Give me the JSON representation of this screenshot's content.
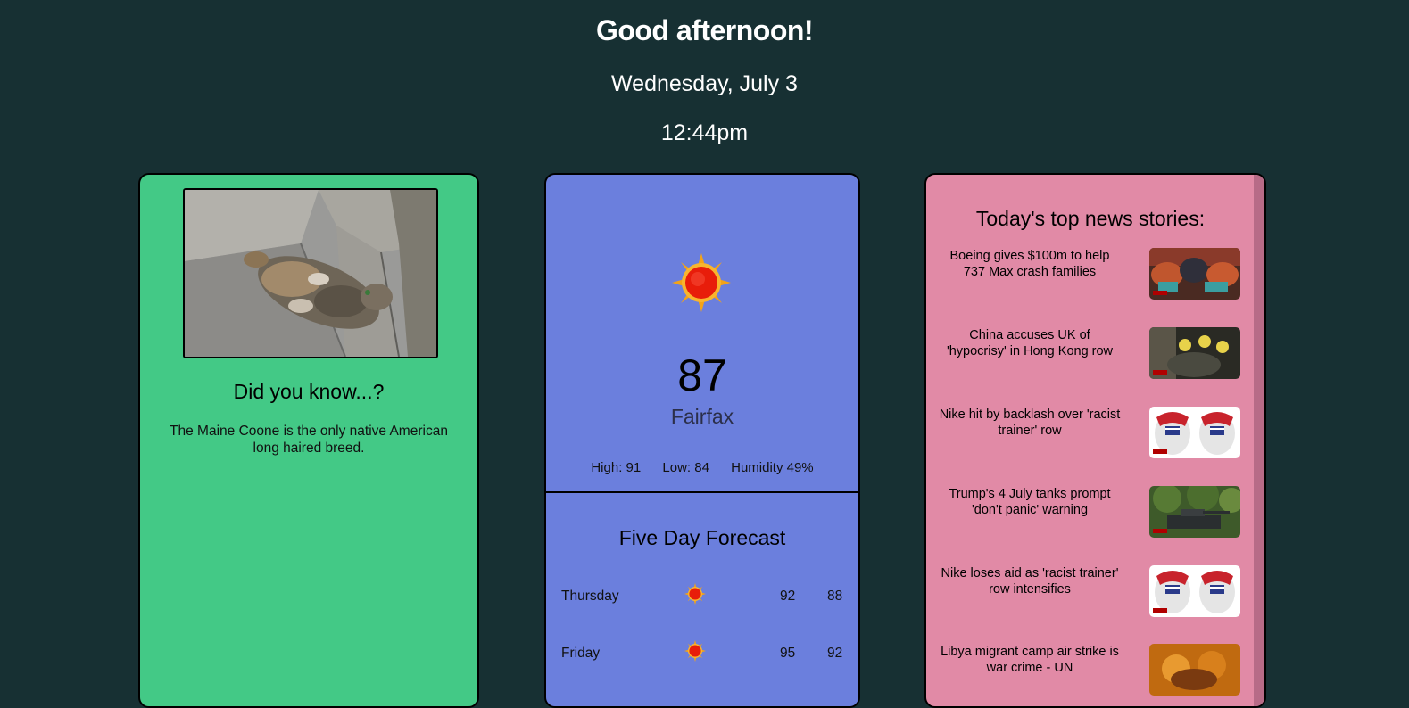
{
  "header": {
    "greeting": "Good afternoon!",
    "date": "Wednesday, July 3",
    "time": "12:44pm"
  },
  "fact": {
    "title": "Did you know...?",
    "text": "The Maine Coone is the only native American long haired breed."
  },
  "weather": {
    "icon": "sun-icon",
    "temperature": "87",
    "city": "Fairfax",
    "high": "High: 91",
    "low": "Low: 84",
    "humidity": "Humidity 49%",
    "forecast_title": "Five Day Forecast",
    "forecast": [
      {
        "day": "Thursday",
        "icon": "sun-icon",
        "high": "92",
        "low": "88"
      },
      {
        "day": "Friday",
        "icon": "sun-icon",
        "high": "95",
        "low": "92"
      }
    ]
  },
  "news": {
    "title": "Today's top news stories:",
    "items": [
      {
        "headline": "Boeing gives $100m to help 737 Max crash families"
      },
      {
        "headline": "China accuses UK of 'hypocrisy' in Hong Kong row"
      },
      {
        "headline": "Nike hit by backlash over 'racist trainer' row"
      },
      {
        "headline": "Trump's 4 July tanks prompt 'don't panic' warning"
      },
      {
        "headline": "Nike loses aid as 'racist trainer' row intensifies"
      },
      {
        "headline": "Libya migrant camp air strike is war crime - UN"
      }
    ]
  },
  "colors": {
    "background": "#173033",
    "fact_card": "#43c986",
    "weather_card": "#6b7fdd",
    "news_card": "#e18aa6"
  }
}
